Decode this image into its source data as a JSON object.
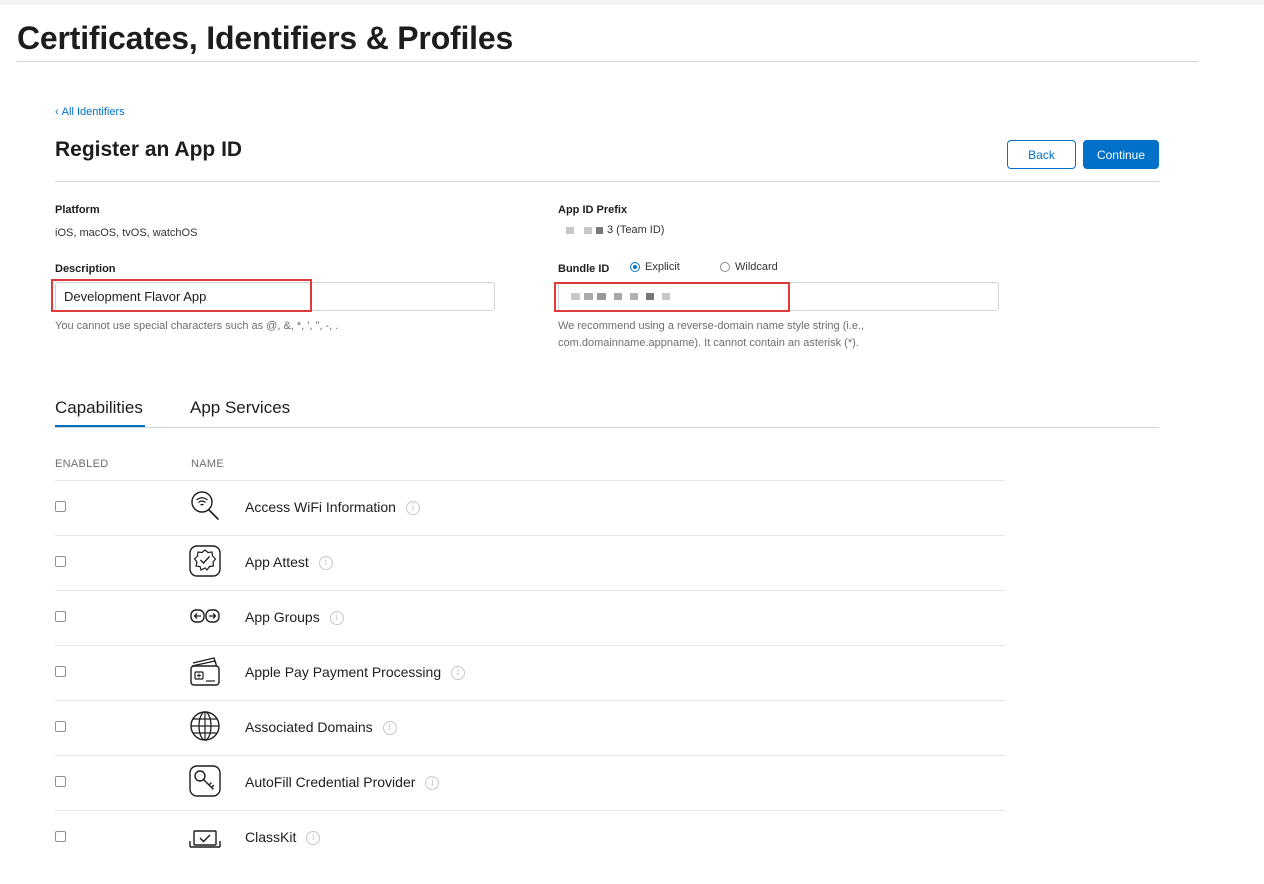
{
  "page": {
    "title": "Certificates, Identifiers & Profiles"
  },
  "breadcrumb": {
    "chevron": "‹",
    "label": "All Identifiers"
  },
  "section": {
    "title": "Register an App ID"
  },
  "buttons": {
    "back": "Back",
    "continue": "Continue"
  },
  "platform": {
    "label": "Platform",
    "value": "iOS, macOS, tvOS, watchOS"
  },
  "app_id_prefix": {
    "label": "App ID Prefix",
    "value_suffix": "3 (Team ID)"
  },
  "description": {
    "label": "Description",
    "value": "Development Flavor App",
    "hint": "You cannot use special characters such as @, &, *, ', \", -, ."
  },
  "bundle_id": {
    "label": "Bundle ID",
    "options": [
      {
        "label": "Explicit",
        "selected": true
      },
      {
        "label": "Wildcard",
        "selected": false
      }
    ],
    "value": "",
    "hint_line1": "We recommend using a reverse-domain name style string (i.e.,",
    "hint_line2": "com.domainname.appname). It cannot contain an asterisk (*)."
  },
  "tabs": [
    {
      "label": "Capabilities",
      "active": true
    },
    {
      "label": "App Services",
      "active": false
    }
  ],
  "table": {
    "columns": {
      "enabled": "ENABLED",
      "name": "NAME"
    },
    "rows": [
      {
        "name": "Access WiFi Information",
        "icon": "wifi-search-icon",
        "enabled": false
      },
      {
        "name": "App Attest",
        "icon": "app-attest-icon",
        "enabled": false
      },
      {
        "name": "App Groups",
        "icon": "app-groups-icon",
        "enabled": false
      },
      {
        "name": "Apple Pay Payment Processing",
        "icon": "apple-pay-icon",
        "enabled": false
      },
      {
        "name": "Associated Domains",
        "icon": "globe-icon",
        "enabled": false
      },
      {
        "name": "AutoFill Credential Provider",
        "icon": "key-icon",
        "enabled": false
      },
      {
        "name": "ClassKit",
        "icon": "classkit-icon",
        "enabled": false
      }
    ]
  },
  "info_glyph": "i",
  "colors": {
    "accent": "#0070c9",
    "highlight_box": "#e03b3b"
  }
}
